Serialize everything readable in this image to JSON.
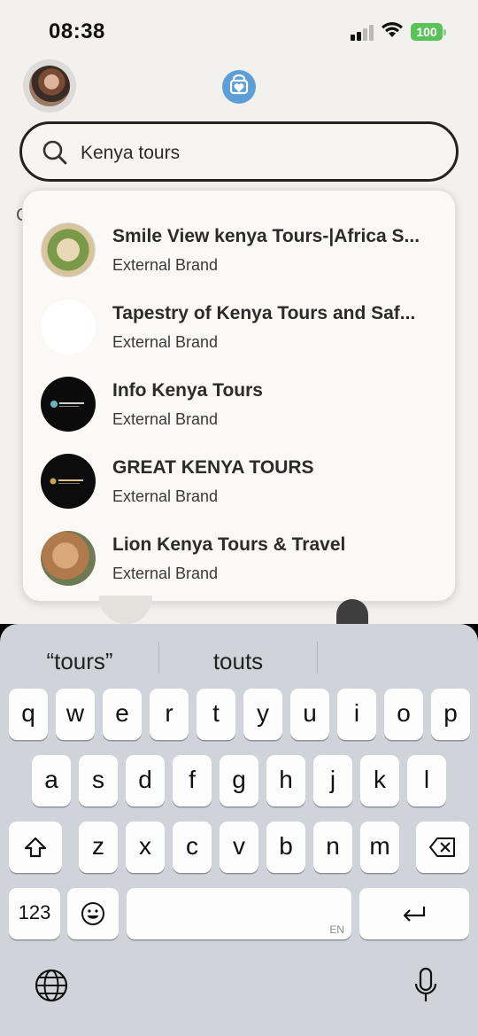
{
  "status_bar": {
    "time": "08:38",
    "battery": "100",
    "icons": [
      "signal-icon",
      "wifi-icon",
      "battery-icon"
    ]
  },
  "header": {
    "avatar": "profile-avatar",
    "logo": "heart-logo-icon"
  },
  "search": {
    "value": "Kenya tours",
    "icon": "search-icon"
  },
  "behind_text": "C",
  "results": [
    {
      "name": "Smile View kenya Tours-|Africa S...",
      "type": "External Brand"
    },
    {
      "name": "Tapestry of Kenya Tours and Saf...",
      "type": "External Brand"
    },
    {
      "name": "Info Kenya Tours",
      "type": "External Brand"
    },
    {
      "name": "GREAT KENYA TOURS",
      "type": "External Brand"
    },
    {
      "name": "Lion Kenya Tours & Travel",
      "type": "External Brand"
    }
  ],
  "keyboard": {
    "suggestions": [
      "“tours”",
      "touts",
      ""
    ],
    "row1": [
      "q",
      "w",
      "e",
      "r",
      "t",
      "y",
      "u",
      "i",
      "o",
      "p"
    ],
    "row2": [
      "a",
      "s",
      "d",
      "f",
      "g",
      "h",
      "j",
      "k",
      "l"
    ],
    "row3": [
      "z",
      "x",
      "c",
      "v",
      "b",
      "n",
      "m"
    ],
    "numbers_key": "123",
    "space_lang": "EN",
    "colors": {
      "background": "#d1d3da",
      "key": "#fdfdfd",
      "special_key": "#aeb3bd"
    }
  },
  "colors": {
    "page_bg": "#f2f1ee",
    "battery_green": "#5bc25a",
    "logo_blue": "#5b9fd6"
  }
}
